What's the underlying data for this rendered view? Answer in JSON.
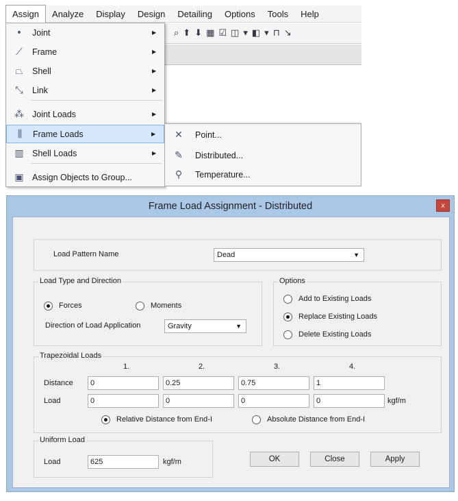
{
  "menubar": {
    "items": [
      "Assign",
      "Analyze",
      "Display",
      "Design",
      "Detailing",
      "Options",
      "Tools",
      "Help"
    ]
  },
  "assign_menu": {
    "items": [
      {
        "label": "Joint",
        "icon": "joint-icon",
        "has_submenu": true
      },
      {
        "label": "Frame",
        "icon": "frame-icon",
        "has_submenu": true
      },
      {
        "label": "Shell",
        "icon": "shell-icon",
        "has_submenu": true
      },
      {
        "label": "Link",
        "icon": "link-icon",
        "has_submenu": true
      },
      {
        "label": "Joint Loads",
        "icon": "joint-loads-icon",
        "has_submenu": true
      },
      {
        "label": "Frame Loads",
        "icon": "frame-loads-icon",
        "has_submenu": true,
        "highlighted": true
      },
      {
        "label": "Shell Loads",
        "icon": "shell-loads-icon",
        "has_submenu": true
      },
      {
        "label": "Assign Objects to Group...",
        "icon": "group-icon",
        "has_submenu": false
      }
    ]
  },
  "frame_loads_submenu": {
    "items": [
      {
        "label": "Point...",
        "icon": "point-load-icon"
      },
      {
        "label": "Distributed...",
        "icon": "distributed-load-icon"
      },
      {
        "label": "Temperature...",
        "icon": "temperature-load-icon"
      }
    ]
  },
  "dialog": {
    "title": "Frame Load Assignment - Distributed",
    "close_glyph": "x",
    "load_pattern": {
      "label": "Load Pattern Name",
      "value": "Dead"
    },
    "load_type": {
      "group_title": "Load Type and Direction",
      "forces_label": "Forces",
      "moments_label": "Moments",
      "selected": "Forces",
      "direction_label": "Direction of Load Application",
      "direction_value": "Gravity"
    },
    "options": {
      "group_title": "Options",
      "add_label": "Add to Existing Loads",
      "replace_label": "Replace Existing Loads",
      "delete_label": "Delete Existing Loads",
      "selected": "Replace Existing Loads"
    },
    "trapezoidal": {
      "group_title": "Trapezoidal Loads",
      "columns": [
        "1.",
        "2.",
        "3.",
        "4."
      ],
      "distance_label": "Distance",
      "load_label": "Load",
      "distance_values": [
        "0",
        "0.25",
        "0.75",
        "1"
      ],
      "load_values": [
        "0",
        "0",
        "0",
        "0"
      ],
      "unit": "kgf/m",
      "relative_label": "Relative Distance from End-I",
      "absolute_label": "Absolute Distance from End-I",
      "selected": "Relative Distance from End-I"
    },
    "uniform": {
      "group_title": "Uniform Load",
      "load_label": "Load",
      "value": "625",
      "unit": "kgf/m"
    },
    "buttons": {
      "ok": "OK",
      "close": "Close",
      "apply": "Apply"
    }
  }
}
